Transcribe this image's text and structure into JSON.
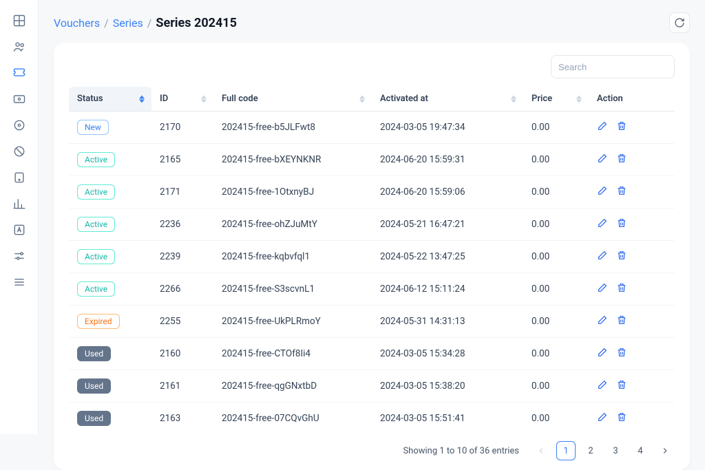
{
  "breadcrumb": {
    "root": "Vouchers",
    "mid": "Series",
    "current": "Series 202415"
  },
  "search": {
    "placeholder": "Search"
  },
  "table": {
    "columns": {
      "status": "Status",
      "id": "ID",
      "code": "Full code",
      "activated": "Activated at",
      "price": "Price",
      "action": "Action"
    },
    "rows": [
      {
        "status": "New",
        "status_type": "new",
        "id": "2170",
        "code": "202415-free-b5JLFwt8",
        "activated": "2024-03-05 19:47:34",
        "price": "0.00"
      },
      {
        "status": "Active",
        "status_type": "active",
        "id": "2165",
        "code": "202415-free-bXEYNKNR",
        "activated": "2024-06-20 15:59:31",
        "price": "0.00"
      },
      {
        "status": "Active",
        "status_type": "active",
        "id": "2171",
        "code": "202415-free-1OtxnyBJ",
        "activated": "2024-06-20 15:59:06",
        "price": "0.00"
      },
      {
        "status": "Active",
        "status_type": "active",
        "id": "2236",
        "code": "202415-free-ohZJuMtY",
        "activated": "2024-05-21 16:47:21",
        "price": "0.00"
      },
      {
        "status": "Active",
        "status_type": "active",
        "id": "2239",
        "code": "202415-free-kqbvfql1",
        "activated": "2024-05-22 13:47:25",
        "price": "0.00"
      },
      {
        "status": "Active",
        "status_type": "active",
        "id": "2266",
        "code": "202415-free-S3scvnL1",
        "activated": "2024-06-12 15:11:24",
        "price": "0.00"
      },
      {
        "status": "Expired",
        "status_type": "expired",
        "id": "2255",
        "code": "202415-free-UkPLRmoY",
        "activated": "2024-05-31 14:31:13",
        "price": "0.00"
      },
      {
        "status": "Used",
        "status_type": "used",
        "id": "2160",
        "code": "202415-free-CTOf8Ii4",
        "activated": "2024-03-05 15:34:28",
        "price": "0.00"
      },
      {
        "status": "Used",
        "status_type": "used",
        "id": "2161",
        "code": "202415-free-qgGNxtbD",
        "activated": "2024-03-05 15:38:20",
        "price": "0.00"
      },
      {
        "status": "Used",
        "status_type": "used",
        "id": "2163",
        "code": "202415-free-07CQvGhU",
        "activated": "2024-03-05 15:51:41",
        "price": "0.00"
      }
    ]
  },
  "footer": {
    "summary": "Showing 1 to 10 of 36 entries",
    "pages": [
      "1",
      "2",
      "3",
      "4"
    ],
    "current_page": "1"
  }
}
